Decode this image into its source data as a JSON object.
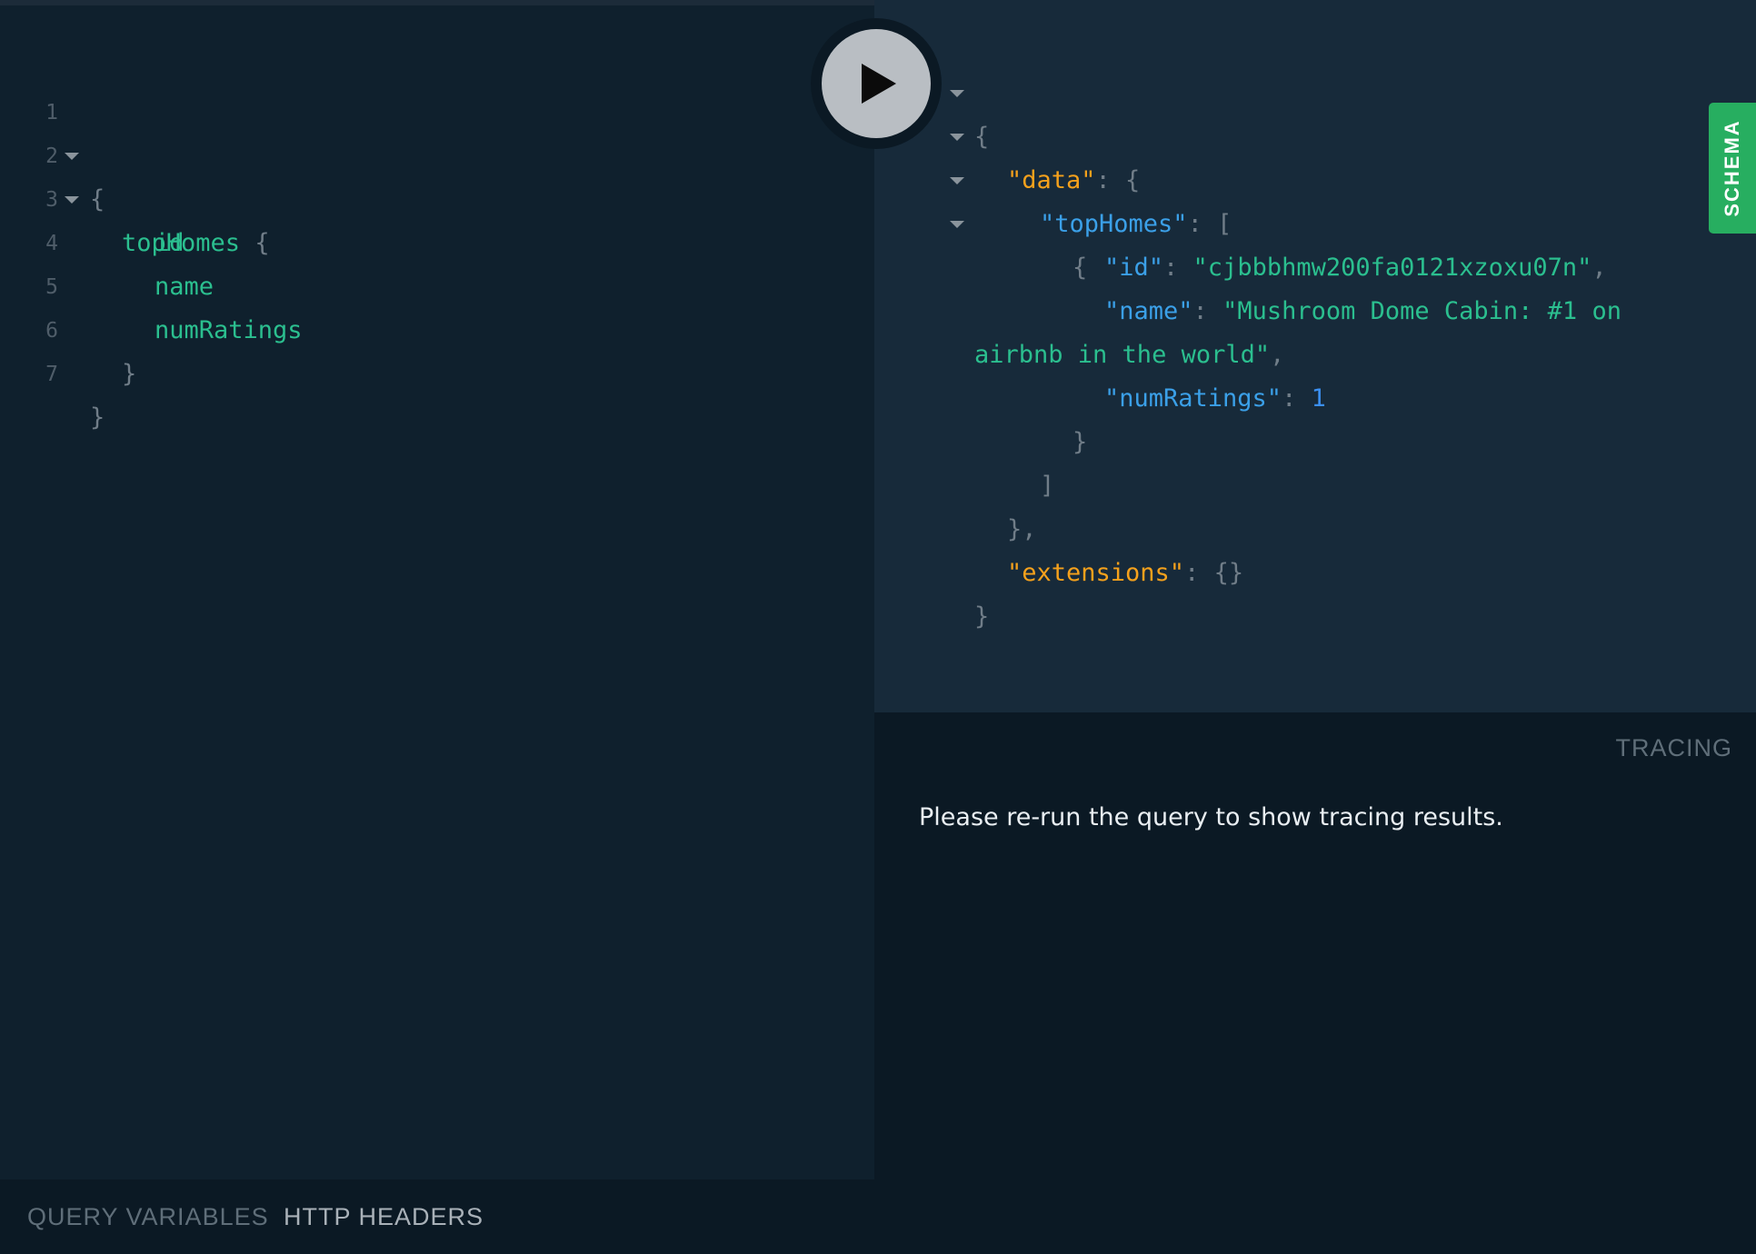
{
  "query_editor": {
    "lines": [
      {
        "number": "1",
        "text": "{"
      },
      {
        "number": "2",
        "text": "topHomes {"
      },
      {
        "number": "3",
        "text": "id"
      },
      {
        "number": "4",
        "text": "name"
      },
      {
        "number": "5",
        "text": "numRatings"
      },
      {
        "number": "6",
        "text": "}"
      },
      {
        "number": "7",
        "text": "}"
      }
    ],
    "tokens": {
      "open_brace": "{",
      "field_top_homes": "topHomes",
      "field_id": "id",
      "field_name": "name",
      "field_num_ratings": "numRatings",
      "close_brace": "}"
    }
  },
  "run_button": {
    "icon": "play-icon"
  },
  "result": {
    "key_data": "\"data\"",
    "key_top_homes": "\"topHomes\"",
    "key_id": "\"id\"",
    "value_id": "\"cjbbbhmw200fa0121xzoxu07n\"",
    "key_name": "\"name\"",
    "value_name_line1": "\"Mushroom Dome Cabin: #1 on",
    "value_name_line2": "airbnb in the world\"",
    "key_num_ratings": "\"numRatings\"",
    "value_num_ratings": "1",
    "key_extensions": "\"extensions\"",
    "value_extensions": "{}"
  },
  "schema_tab": {
    "label": "SCHEMA"
  },
  "tracing": {
    "title": "TRACING",
    "message": "Please re-run the query to show tracing results."
  },
  "bottom_tabs": {
    "query_variables": "QUERY VARIABLES",
    "http_headers": "HTTP HEADERS"
  },
  "colors": {
    "field": "#2bbf8f",
    "root_key": "#f5a11c",
    "key": "#3ba0e8",
    "number": "#3b8ff0",
    "schema_accent": "#27ae60"
  }
}
